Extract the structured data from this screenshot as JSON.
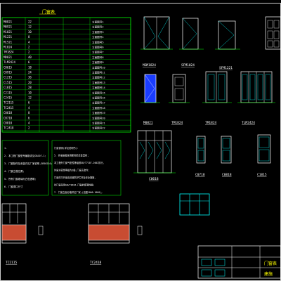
{
  "schedule": {
    "title": "门窗表",
    "rows": [
      [
        "M0821",
        "22",
        "立面图号1"
      ],
      [
        "M0921",
        "12",
        "立面图号2"
      ],
      [
        "M1021",
        "30",
        "立面图号3"
      ],
      [
        "M1221",
        "8",
        "立面图号4"
      ],
      [
        "M1521",
        "4",
        "立面图号5"
      ],
      [
        "M1824",
        "2",
        "立面图号6"
      ],
      [
        "TM1824",
        "2",
        "立面图号7"
      ],
      [
        "MD821",
        "40",
        "立面图号8"
      ],
      [
        "TLM2424",
        "6",
        "立面图号9"
      ],
      [
        "C0615",
        "18",
        "立面图号10"
      ],
      [
        "C0915",
        "24",
        "立面图号11"
      ],
      [
        "C1215",
        "36",
        "立面图号12"
      ],
      [
        "C1515",
        "20",
        "立面图号13"
      ],
      [
        "C1815",
        "28",
        "立面图号14"
      ],
      [
        "C2115",
        "10",
        "立面图号15"
      ],
      [
        "C2415",
        "12",
        "立面图号16"
      ],
      [
        "TC2115",
        "6",
        "立面图号17"
      ],
      [
        "TC2415",
        "4",
        "立面图号18"
      ],
      [
        "C0618",
        "8",
        "立面图号19"
      ],
      [
        "C0718",
        "6",
        "立面图号20"
      ],
      [
        "C0818",
        "4",
        "立面图号21"
      ],
      [
        "TC2418",
        "2",
        "立面图号22"
      ]
    ]
  },
  "elevations": [
    {
      "label": "MGM1824"
    },
    {
      "label": "SFM1024"
    },
    {
      "label": "SFM1221"
    },
    {
      "label": ""
    },
    {
      "label": "M0821"
    },
    {
      "label": "TM1824"
    },
    {
      "label": "TM1824"
    },
    {
      "label": "TLM2424"
    },
    {
      "label": "C0618"
    },
    {
      "label": "C0718"
    },
    {
      "label": "C0818"
    },
    {
      "label": "C1815"
    },
    {
      "label": "TC2115"
    },
    {
      "label": "TC2418"
    }
  ],
  "notes_left": {
    "lines": [
      "1.",
      "2. 本工程门窗型号编制详见GBJ07-1;",
      "3. 门窗制作及安装详见厂家说明,GB50210;",
      "4. 门窗立樘位置;",
      "5. 所有门窗玻璃为白色透明;",
      "6. 门窗洞口尺寸"
    ]
  },
  "notes_right": {
    "lines": [
      "门窗说明(详见说明书):",
      "5. 外窗窗框采用断热铝合金型材;",
      "本工程外门窗气密性等级按GB/T7107-2002执行,",
      "外窗水密性等级为3级,门窗五金件;",
      "门窗的平开窗应设置防护栏杆及安全措施,",
      "外门窗采用GB/T8484,门窗的保温性能;",
      "7. 门窗立面分格详见厂家;(见图1000-1000);"
    ]
  },
  "titleblock": {
    "sheet": "门窗表",
    "no": "建施"
  },
  "colors": {
    "bg": "#000000",
    "line": "#00ff00",
    "text": "#ffffff",
    "cyan": "#00ffff",
    "yellow": "#ffff00",
    "red": "#c84c32",
    "blue": "#1a3cff",
    "magenta": "#ff00ff"
  }
}
